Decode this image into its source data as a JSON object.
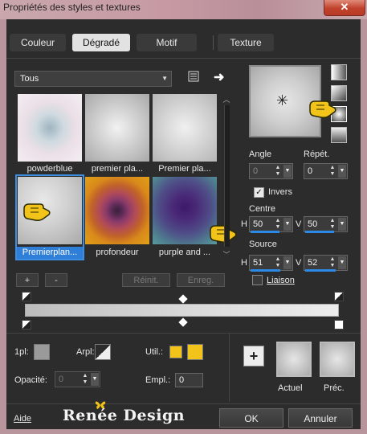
{
  "window": {
    "title": "Propriétés des styles et textures",
    "close": "✕"
  },
  "tabs": [
    {
      "label": "Couleur",
      "active": false
    },
    {
      "label": "Dégradé",
      "active": true
    },
    {
      "label": "Motif",
      "active": false
    },
    {
      "label": "Texture",
      "active": false
    }
  ],
  "category_dropdown": {
    "value": "Tous"
  },
  "gradients": [
    {
      "label": "powderblue"
    },
    {
      "label": "premier pla..."
    },
    {
      "label": "Premier pla..."
    },
    {
      "label": "Premierplan...",
      "selected": true
    },
    {
      "label": "profondeur"
    },
    {
      "label": "purple and ..."
    }
  ],
  "buttons": {
    "add": "+",
    "remove": "-",
    "reset": "Réinit.",
    "save": "Enreg.",
    "ok": "OK",
    "cancel": "Annuler",
    "help": "Aide",
    "new": "+"
  },
  "angle": {
    "label": "Angle",
    "value": "0"
  },
  "repeat": {
    "label": "Répét.",
    "value": "0"
  },
  "invert": {
    "label": "Invers",
    "checked": true
  },
  "center": {
    "label": "Centre",
    "h_label": "H",
    "h": "50",
    "v_label": "V",
    "v": "50"
  },
  "source": {
    "label": "Source",
    "h_label": "H",
    "h": "51",
    "v_label": "V",
    "v": "52"
  },
  "link": {
    "label": "Liaison",
    "checked": false
  },
  "lower": {
    "pl_label": "1pl:",
    "arpl_label": "Arpl:",
    "util_label": "Util.:",
    "opacity_label": "Opacité:",
    "opacity_value": "0",
    "empl_label": "Empl.:",
    "empl_value": "0",
    "util_color": "#f2c318"
  },
  "previews": {
    "current_label": "Actuel",
    "previous_label": "Préc."
  },
  "logo": {
    "text": "Renée Design"
  },
  "colors": {
    "accent": "#2d89e6",
    "tab_active": "#e2e2e2",
    "pointer": "#f2c318"
  }
}
